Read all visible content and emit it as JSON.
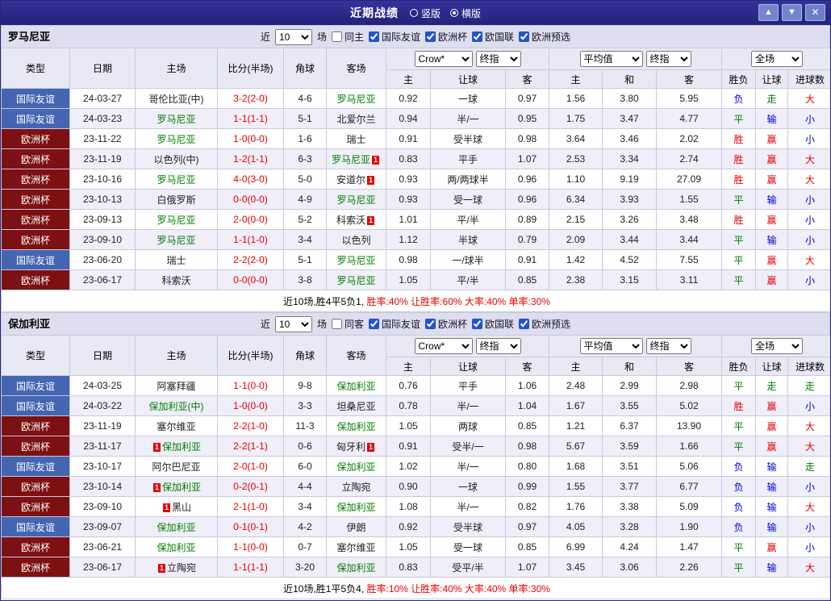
{
  "titlebar": {
    "title": "近期战绩",
    "view_options": [
      {
        "label": "竖版",
        "selected": false
      },
      {
        "label": "横版",
        "selected": true
      }
    ],
    "icons": {
      "up": "▲",
      "down": "▼",
      "close": "✕"
    }
  },
  "table": {
    "card_label": "1",
    "group_headers": {
      "bookmaker": "Crow*",
      "final_a": "终指",
      "average": "平均值",
      "final_b": "终指",
      "scope": "全场"
    },
    "sub_headers": [
      "类型",
      "日期",
      "主场",
      "比分(半场)",
      "角球",
      "客场",
      "主",
      "让球",
      "客",
      "主",
      "和",
      "客",
      "胜负",
      "让球",
      "进球数"
    ]
  },
  "sections": [
    {
      "team": "罗马尼亚",
      "filter": {
        "near": "近",
        "count": "10",
        "games": "场",
        "same": "同主",
        "same_checked": false,
        "competitions": [
          {
            "label": "国际友谊",
            "checked": true
          },
          {
            "label": "欧洲杯",
            "checked": true
          },
          {
            "label": "欧国联",
            "checked": true
          },
          {
            "label": "欧洲预选",
            "checked": true
          }
        ]
      },
      "rows": [
        {
          "type": "国际友谊",
          "typeStyle": "blue",
          "date": "24-03-27",
          "home": "哥伦比亚(中)",
          "score": "3-2(2-0)",
          "corner": "4-6",
          "away": "罗马尼亚",
          "awayFocal": true,
          "asian": [
            "0.92",
            "一球",
            "0.97"
          ],
          "euro": [
            "1.56",
            "3.80",
            "5.95"
          ],
          "results": [
            {
              "t": "负",
              "c": "blue"
            },
            {
              "t": "走",
              "c": "green"
            },
            {
              "t": "大",
              "c": "red"
            }
          ]
        },
        {
          "type": "国际友谊",
          "typeStyle": "blue",
          "date": "24-03-23",
          "home": "罗马尼亚",
          "homeFocal": true,
          "score": "1-1(1-1)",
          "corner": "5-1",
          "away": "北爱尔兰",
          "asian": [
            "0.94",
            "半/一",
            "0.95"
          ],
          "euro": [
            "1.75",
            "3.47",
            "4.77"
          ],
          "results": [
            {
              "t": "平",
              "c": "green"
            },
            {
              "t": "输",
              "c": "blue"
            },
            {
              "t": "小",
              "c": "blue"
            }
          ]
        },
        {
          "type": "欧洲杯",
          "typeStyle": "maroon",
          "date": "23-11-22",
          "home": "罗马尼亚",
          "homeFocal": true,
          "score": "1-0(0-0)",
          "corner": "1-6",
          "away": "瑞士",
          "asian": [
            "0.91",
            "受半球",
            "0.98"
          ],
          "euro": [
            "3.64",
            "3.46",
            "2.02"
          ],
          "results": [
            {
              "t": "胜",
              "c": "red"
            },
            {
              "t": "赢",
              "c": "red"
            },
            {
              "t": "小",
              "c": "blue"
            }
          ]
        },
        {
          "type": "欧洲杯",
          "typeStyle": "maroon",
          "date": "23-11-19",
          "home": "以色列(中)",
          "score": "1-2(1-1)",
          "corner": "6-3",
          "away": "罗马尼亚",
          "awayFocal": true,
          "awayCard": true,
          "asian": [
            "0.83",
            "平手",
            "1.07"
          ],
          "euro": [
            "2.53",
            "3.34",
            "2.74"
          ],
          "results": [
            {
              "t": "胜",
              "c": "red"
            },
            {
              "t": "赢",
              "c": "red"
            },
            {
              "t": "大",
              "c": "red"
            }
          ]
        },
        {
          "type": "欧洲杯",
          "typeStyle": "maroon",
          "date": "23-10-16",
          "home": "罗马尼亚",
          "homeFocal": true,
          "score": "4-0(3-0)",
          "corner": "5-0",
          "away": "安道尔",
          "awayCard": true,
          "asian": [
            "0.93",
            "两/两球半",
            "0.96"
          ],
          "euro": [
            "1.10",
            "9.19",
            "27.09"
          ],
          "results": [
            {
              "t": "胜",
              "c": "red"
            },
            {
              "t": "赢",
              "c": "red"
            },
            {
              "t": "大",
              "c": "red"
            }
          ]
        },
        {
          "type": "欧洲杯",
          "typeStyle": "maroon",
          "date": "23-10-13",
          "home": "白俄罗斯",
          "score": "0-0(0-0)",
          "corner": "4-9",
          "away": "罗马尼亚",
          "awayFocal": true,
          "asian": [
            "0.93",
            "受一球",
            "0.96"
          ],
          "euro": [
            "6.34",
            "3.93",
            "1.55"
          ],
          "results": [
            {
              "t": "平",
              "c": "green"
            },
            {
              "t": "输",
              "c": "blue"
            },
            {
              "t": "小",
              "c": "blue"
            }
          ]
        },
        {
          "type": "欧洲杯",
          "typeStyle": "maroon",
          "date": "23-09-13",
          "home": "罗马尼亚",
          "homeFocal": true,
          "score": "2-0(0-0)",
          "corner": "5-2",
          "away": "科索沃",
          "awayCard": true,
          "asian": [
            "1.01",
            "平/半",
            "0.89"
          ],
          "euro": [
            "2.15",
            "3.26",
            "3.48"
          ],
          "results": [
            {
              "t": "胜",
              "c": "red"
            },
            {
              "t": "赢",
              "c": "red"
            },
            {
              "t": "小",
              "c": "blue"
            }
          ]
        },
        {
          "type": "欧洲杯",
          "typeStyle": "maroon",
          "date": "23-09-10",
          "home": "罗马尼亚",
          "homeFocal": true,
          "score": "1-1(1-0)",
          "corner": "3-4",
          "away": "以色列",
          "asian": [
            "1.12",
            "半球",
            "0.79"
          ],
          "euro": [
            "2.09",
            "3.44",
            "3.44"
          ],
          "results": [
            {
              "t": "平",
              "c": "green"
            },
            {
              "t": "输",
              "c": "blue"
            },
            {
              "t": "小",
              "c": "blue"
            }
          ]
        },
        {
          "type": "国际友谊",
          "typeStyle": "blue",
          "date": "23-06-20",
          "home": "瑞士",
          "score": "2-2(2-0)",
          "corner": "5-1",
          "away": "罗马尼亚",
          "awayFocal": true,
          "asian": [
            "0.98",
            "一/球半",
            "0.91"
          ],
          "euro": [
            "1.42",
            "4.52",
            "7.55"
          ],
          "results": [
            {
              "t": "平",
              "c": "green"
            },
            {
              "t": "赢",
              "c": "red"
            },
            {
              "t": "大",
              "c": "red"
            }
          ]
        },
        {
          "type": "欧洲杯",
          "typeStyle": "maroon",
          "date": "23-06-17",
          "home": "科索沃",
          "score": "0-0(0-0)",
          "corner": "3-8",
          "away": "罗马尼亚",
          "awayFocal": true,
          "asian": [
            "1.05",
            "平/半",
            "0.85"
          ],
          "euro": [
            "2.38",
            "3.15",
            "3.11"
          ],
          "results": [
            {
              "t": "平",
              "c": "green"
            },
            {
              "t": "赢",
              "c": "red"
            },
            {
              "t": "小",
              "c": "blue"
            }
          ]
        }
      ],
      "summary": {
        "record": "近10场,胜4平5负1,",
        "rates": "胜率:40% 让胜率:60% 大率:40% 单率:30%"
      }
    },
    {
      "team": "保加利亚",
      "filter": {
        "near": "近",
        "count": "10",
        "games": "场",
        "same": "同客",
        "same_checked": false,
        "competitions": [
          {
            "label": "国际友谊",
            "checked": true
          },
          {
            "label": "欧洲杯",
            "checked": true
          },
          {
            "label": "欧国联",
            "checked": true
          },
          {
            "label": "欧洲预选",
            "checked": true
          }
        ]
      },
      "rows": [
        {
          "type": "国际友谊",
          "typeStyle": "blue",
          "date": "24-03-25",
          "home": "阿塞拜疆",
          "score": "1-1(0-0)",
          "corner": "9-8",
          "away": "保加利亚",
          "awayFocal": true,
          "asian": [
            "0.76",
            "平手",
            "1.06"
          ],
          "euro": [
            "2.48",
            "2.99",
            "2.98"
          ],
          "results": [
            {
              "t": "平",
              "c": "green"
            },
            {
              "t": "走",
              "c": "green"
            },
            {
              "t": "走",
              "c": "green"
            }
          ]
        },
        {
          "type": "国际友谊",
          "typeStyle": "blue",
          "date": "24-03-22",
          "home": "保加利亚(中)",
          "homeFocal": true,
          "score": "1-0(0-0)",
          "corner": "3-3",
          "away": "坦桑尼亚",
          "asian": [
            "0.78",
            "半/一",
            "1.04"
          ],
          "euro": [
            "1.67",
            "3.55",
            "5.02"
          ],
          "results": [
            {
              "t": "胜",
              "c": "red"
            },
            {
              "t": "赢",
              "c": "red"
            },
            {
              "t": "小",
              "c": "blue"
            }
          ]
        },
        {
          "type": "欧洲杯",
          "typeStyle": "maroon",
          "date": "23-11-19",
          "home": "塞尔维亚",
          "score": "2-2(1-0)",
          "corner": "11-3",
          "away": "保加利亚",
          "awayFocal": true,
          "asian": [
            "1.05",
            "两球",
            "0.85"
          ],
          "euro": [
            "1.21",
            "6.37",
            "13.90"
          ],
          "results": [
            {
              "t": "平",
              "c": "green"
            },
            {
              "t": "赢",
              "c": "red"
            },
            {
              "t": "大",
              "c": "red"
            }
          ]
        },
        {
          "type": "欧洲杯",
          "typeStyle": "maroon",
          "date": "23-11-17",
          "home": "保加利亚",
          "homeFocal": true,
          "homeCard": true,
          "score": "2-2(1-1)",
          "corner": "0-6",
          "away": "匈牙利",
          "awayCard": true,
          "asian": [
            "0.91",
            "受半/一",
            "0.98"
          ],
          "euro": [
            "5.67",
            "3.59",
            "1.66"
          ],
          "results": [
            {
              "t": "平",
              "c": "green"
            },
            {
              "t": "赢",
              "c": "red"
            },
            {
              "t": "大",
              "c": "red"
            }
          ]
        },
        {
          "type": "国际友谊",
          "typeStyle": "blue",
          "date": "23-10-17",
          "home": "阿尔巴尼亚",
          "score": "2-0(1-0)",
          "corner": "6-0",
          "away": "保加利亚",
          "awayFocal": true,
          "asian": [
            "1.02",
            "半/一",
            "0.80"
          ],
          "euro": [
            "1.68",
            "3.51",
            "5.06"
          ],
          "results": [
            {
              "t": "负",
              "c": "blue"
            },
            {
              "t": "输",
              "c": "blue"
            },
            {
              "t": "走",
              "c": "green"
            }
          ]
        },
        {
          "type": "欧洲杯",
          "typeStyle": "maroon",
          "date": "23-10-14",
          "home": "保加利亚",
          "homeFocal": true,
          "homeCard": true,
          "score": "0-2(0-1)",
          "corner": "4-4",
          "away": "立陶宛",
          "asian": [
            "0.90",
            "一球",
            "0.99"
          ],
          "euro": [
            "1.55",
            "3.77",
            "6.77"
          ],
          "results": [
            {
              "t": "负",
              "c": "blue"
            },
            {
              "t": "输",
              "c": "blue"
            },
            {
              "t": "小",
              "c": "blue"
            }
          ]
        },
        {
          "type": "欧洲杯",
          "typeStyle": "maroon",
          "date": "23-09-10",
          "home": "黑山",
          "homeCard": true,
          "score": "2-1(1-0)",
          "corner": "3-4",
          "away": "保加利亚",
          "awayFocal": true,
          "asian": [
            "1.08",
            "半/一",
            "0.82"
          ],
          "euro": [
            "1.76",
            "3.38",
            "5.09"
          ],
          "results": [
            {
              "t": "负",
              "c": "blue"
            },
            {
              "t": "输",
              "c": "blue"
            },
            {
              "t": "大",
              "c": "red"
            }
          ]
        },
        {
          "type": "国际友谊",
          "typeStyle": "blue",
          "date": "23-09-07",
          "home": "保加利亚",
          "homeFocal": true,
          "score": "0-1(0-1)",
          "corner": "4-2",
          "away": "伊朗",
          "asian": [
            "0.92",
            "受半球",
            "0.97"
          ],
          "euro": [
            "4.05",
            "3.28",
            "1.90"
          ],
          "results": [
            {
              "t": "负",
              "c": "blue"
            },
            {
              "t": "输",
              "c": "blue"
            },
            {
              "t": "小",
              "c": "blue"
            }
          ]
        },
        {
          "type": "欧洲杯",
          "typeStyle": "maroon",
          "date": "23-06-21",
          "home": "保加利亚",
          "homeFocal": true,
          "score": "1-1(0-0)",
          "corner": "0-7",
          "away": "塞尔维亚",
          "asian": [
            "1.05",
            "受一球",
            "0.85"
          ],
          "euro": [
            "6.99",
            "4.24",
            "1.47"
          ],
          "results": [
            {
              "t": "平",
              "c": "green"
            },
            {
              "t": "赢",
              "c": "red"
            },
            {
              "t": "小",
              "c": "blue"
            }
          ]
        },
        {
          "type": "欧洲杯",
          "typeStyle": "maroon",
          "date": "23-06-17",
          "home": "立陶宛",
          "homeCard": true,
          "score": "1-1(1-1)",
          "corner": "3-20",
          "away": "保加利亚",
          "awayFocal": true,
          "asian": [
            "0.83",
            "受平/半",
            "1.07"
          ],
          "euro": [
            "3.45",
            "3.06",
            "2.26"
          ],
          "results": [
            {
              "t": "平",
              "c": "green"
            },
            {
              "t": "输",
              "c": "blue"
            },
            {
              "t": "大",
              "c": "red"
            }
          ]
        }
      ],
      "summary": {
        "record": "近10场,胜1平5负4,",
        "rates": "胜率:10% 让胜率:40% 大率:40% 单率:30%"
      }
    }
  ]
}
